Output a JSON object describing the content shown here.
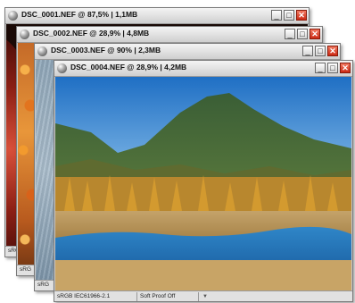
{
  "windows": [
    {
      "title": "DSC_0001.NEF @ 87,5% | 1,1MB",
      "color_profile": "sRG"
    },
    {
      "title": "DSC_0002.NEF @ 28,9% | 4,8MB",
      "color_profile": "sRG"
    },
    {
      "title": "DSC_0003.NEF @ 90% | 2,3MB",
      "color_profile": "sRG"
    },
    {
      "title": "DSC_0004.NEF @ 28,9% | 4,2MB",
      "color_profile": "sRGB IEC61966-2.1",
      "proof_setting": "Soft Proof Off"
    }
  ],
  "controls": {
    "minimize": "_",
    "maximize": "□",
    "close": "✕",
    "menu_arrow": "▼"
  },
  "icons": {
    "document": "sphere-icon"
  }
}
